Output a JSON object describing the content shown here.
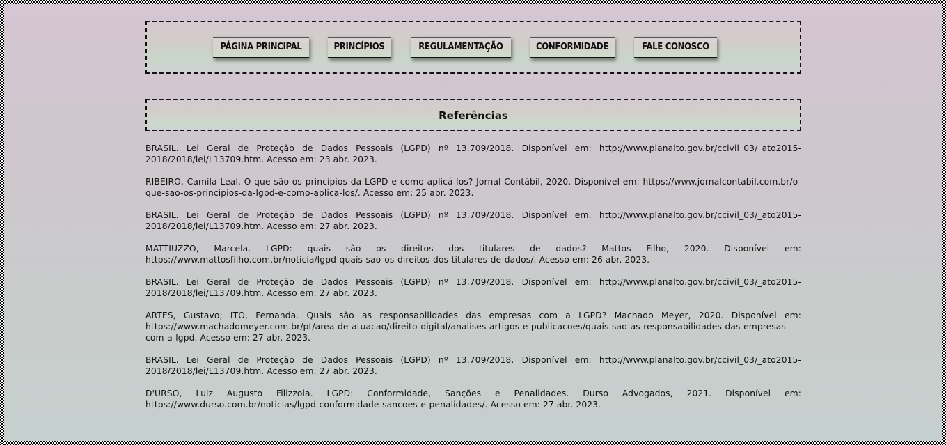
{
  "nav": {
    "items": [
      {
        "label": "PÁGINA PRINCIPAL"
      },
      {
        "label": "PRINCÍPIOS"
      },
      {
        "label": "REGULAMENTAÇÃO"
      },
      {
        "label": "CONFORMIDADE"
      },
      {
        "label": "FALE CONOSCO"
      }
    ]
  },
  "page": {
    "title": "Referências"
  },
  "references": [
    {
      "text": "BRASIL. Lei Geral de Proteção de Dados Pessoais (LGPD) nº 13.709/2018. Disponível em: http://www.planalto.gov.br/ccivil_03/_ato2015-2018/2018/lei/L13709.htm. Acesso em: 23 abr. 2023."
    },
    {
      "text": "RIBEIRO, Camila Leal. O que são os princípios da LGPD e como aplicá-los? Jornal Contábil, 2020. Disponível em: https://www.jornalcontabil.com.br/o-que-sao-os-principios-da-lgpd-e-como-aplica-los/. Acesso em: 25 abr. 2023."
    },
    {
      "text": "BRASIL. Lei Geral de Proteção de Dados Pessoais (LGPD) nº 13.709/2018. Disponível em: http://www.planalto.gov.br/ccivil_03/_ato2015-2018/2018/lei/L13709.htm. Acesso em: 27 abr. 2023."
    },
    {
      "text": "MATTIUZZO, Marcela. LGPD: quais são os direitos dos titulares de dados? Mattos Filho, 2020. Disponível em: https://www.mattosfilho.com.br/noticia/lgpd-quais-sao-os-direitos-dos-titulares-de-dados/. Acesso em: 26 abr. 2023."
    },
    {
      "text": "BRASIL. Lei Geral de Proteção de Dados Pessoais (LGPD) nº 13.709/2018. Disponível em: http://www.planalto.gov.br/ccivil_03/_ato2015-2018/2018/lei/L13709.htm. Acesso em: 27 abr. 2023."
    },
    {
      "text": "ARTES, Gustavo; ITO, Fernanda. Quais são as responsabilidades das empresas com a LGPD? Machado Meyer, 2020. Disponível em: https://www.machadomeyer.com.br/pt/area-de-atuacao/direito-digital/analises-artigos-e-publicacoes/quais-sao-as-responsabilidades-das-empresas-com-a-lgpd. Acesso em: 27 abr. 2023."
    },
    {
      "text": "BRASIL. Lei Geral de Proteção de Dados Pessoais (LGPD) nº 13.709/2018. Disponível em: http://www.planalto.gov.br/ccivil_03/_ato2015-2018/2018/lei/L13709.htm. Acesso em: 27 abr. 2023."
    },
    {
      "text": "D'URSO, Luiz Augusto Filizzola. LGPD: Conformidade, Sanções e Penalidades. Durso Advogados, 2021. Disponível em: https://www.durso.com.br/noticias/lgpd-conformidade-sancoes-e-penalidades/. Acesso em: 27 abr. 2023."
    }
  ]
}
